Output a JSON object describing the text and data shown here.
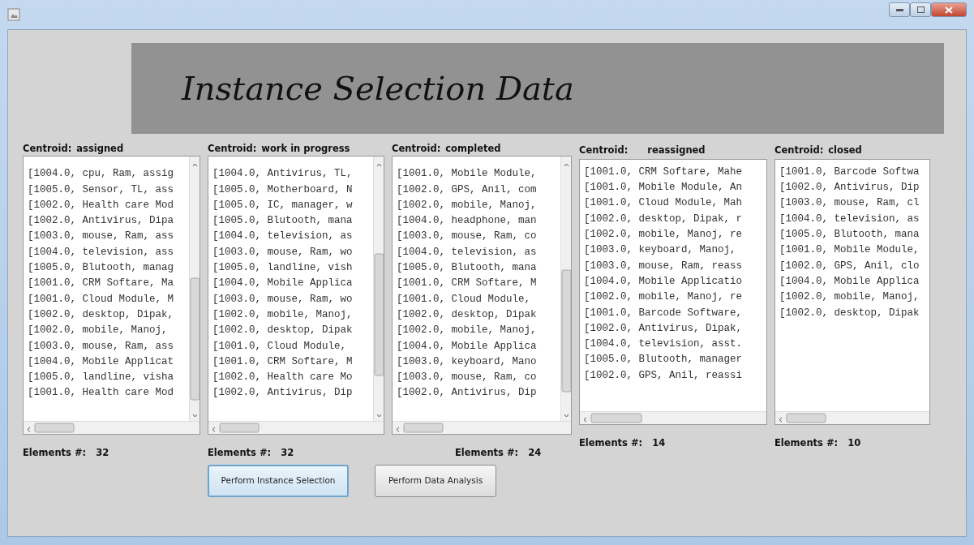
{
  "banner": {
    "title": "Instance Selection Data"
  },
  "clusters": [
    {
      "label": "Centroid:",
      "name": "assigned",
      "count_label": "Elements #:",
      "count": "32",
      "vscroll": true,
      "rows": [
        "[1004.0, cpu, Ram, assig",
        "[1005.0, Sensor, TL, ass",
        "[1002.0, Health care Mod",
        "[1002.0, Antivirus, Dipa",
        "[1003.0, mouse, Ram, ass",
        "[1004.0, television, ass",
        "[1005.0, Blutooth, manag",
        "[1001.0, CRM Softare, Ma",
        "[1001.0, Cloud Module, M",
        "[1002.0, desktop, Dipak,",
        "[1002.0, mobile, Manoj,",
        "[1003.0, mouse, Ram, ass",
        "[1004.0, Mobile Applicat",
        "[1005.0, landline, visha",
        "[1001.0, Health care Mod"
      ]
    },
    {
      "label": "Centroid:",
      "name": "work in progress",
      "count_label": "Elements #:",
      "count": "32",
      "vscroll": true,
      "rows": [
        "[1004.0, Antivirus, TL,",
        "[1005.0, Motherboard, N",
        "[1005.0, IC, manager, w",
        "[1005.0, Blutooth, mana",
        "[1004.0, television, as",
        "[1003.0, mouse, Ram, wo",
        "[1005.0, landline, vish",
        "[1004.0, Mobile Applica",
        "[1003.0, mouse, Ram, wo",
        "[1002.0, mobile, Manoj,",
        "[1002.0, desktop, Dipak",
        "[1001.0, Cloud Module,",
        "[1001.0, CRM Softare, M",
        "[1002.0, Health care Mo",
        "[1002.0, Antivirus, Dip"
      ]
    },
    {
      "label": "Centroid:",
      "name": "completed",
      "count_label": "Elements #:",
      "count": "24",
      "vscroll": true,
      "rows": [
        "[1001.0, Mobile Module,",
        "[1002.0, GPS, Anil, com",
        "[1002.0, mobile, Manoj,",
        "[1004.0, headphone, man",
        "[1003.0, mouse, Ram, co",
        "[1004.0, television, as",
        "[1005.0, Blutooth, mana",
        "[1001.0, CRM Softare, M",
        "[1001.0, Cloud Module,",
        "[1002.0, desktop, Dipak",
        "[1002.0, mobile, Manoj,",
        "[1004.0, Mobile Applica",
        "[1003.0, keyboard, Mano",
        "[1003.0, mouse, Ram, co",
        "[1002.0, Antivirus, Dip"
      ]
    },
    {
      "label": "Centroid:",
      "name": "reassigned",
      "count_label": "Elements #:",
      "count": "14",
      "vscroll": false,
      "rows": [
        "[1001.0, CRM Softare, Mahe",
        "[1001.0, Mobile Module, An",
        "[1001.0, Cloud Module, Mah",
        "[1002.0, desktop, Dipak, r",
        "[1002.0, mobile, Manoj, re",
        "[1003.0, keyboard, Manoj,",
        "[1003.0, mouse, Ram, reass",
        "[1004.0, Mobile Applicatio",
        "[1002.0, mobile, Manoj, re",
        "[1001.0, Barcode Software,",
        "[1002.0, Antivirus, Dipak,",
        "[1004.0, television, asst.",
        "[1005.0, Blutooth, manager",
        "[1002.0, GPS, Anil, reassi"
      ]
    },
    {
      "label": "Centroid:",
      "name": "closed",
      "count_label": "Elements #:",
      "count": "10",
      "vscroll": false,
      "rows": [
        "[1001.0, Barcode Softwa",
        "[1002.0, Antivirus, Dip",
        "[1003.0, mouse, Ram, cl",
        "[1004.0, television, as",
        "[1005.0, Blutooth, mana",
        "[1001.0, Mobile Module,",
        "[1002.0, GPS, Anil, clo",
        "[1004.0, Mobile Applica",
        "[1002.0, mobile, Manoj,",
        "[1002.0, desktop, Dipak"
      ]
    }
  ],
  "buttons": [
    {
      "label": "Perform Instance Selection",
      "focused": true
    },
    {
      "label": "Perform Data Analysis",
      "focused": false
    }
  ]
}
